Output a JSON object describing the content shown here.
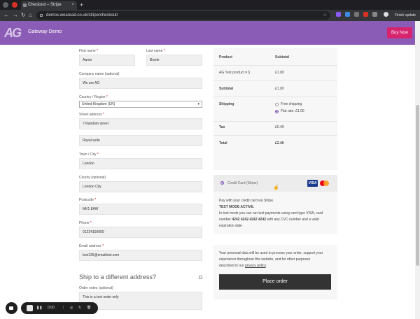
{
  "browser": {
    "tab_title": "Checkout – Stripe",
    "url": "demos.wearead.co.uk/stripe/checkout/",
    "update_label": "Finish update"
  },
  "header": {
    "logo_text": "AG",
    "brand": "Gateway Demo",
    "buy_now": "Buy Now"
  },
  "billing": {
    "first_name_label": "First name",
    "first_name": "Aaron",
    "last_name_label": "Last name",
    "last_name": "Bowie",
    "company_label": "Company name (optional)",
    "company": "We are AG",
    "country_label": "Country / Region",
    "country": "United Kingdom (UK)",
    "street_label": "Street address",
    "street1": "7 Random street",
    "street2": "Royal suite",
    "city_label": "Town / City",
    "city": "London",
    "county_label": "County (optional)",
    "county": "London City",
    "postcode_label": "Postcode",
    "postcode": "MK1 8AW",
    "phone_label": "Phone",
    "phone": "01224100000",
    "email_label": "Email address",
    "email": "test135@emailtest.com",
    "required_mark": "*"
  },
  "shipping": {
    "ship_diff_label": "Ship to a different address?",
    "notes_label": "Order notes (optional)",
    "notes": "This is a test order only"
  },
  "order": {
    "col_product": "Product",
    "col_subtotal": "Subtotal",
    "item_name": "AG Test product",
    "item_qty": "× 1",
    "item_price": "£1.00",
    "subtotal_label": "Subtotal",
    "subtotal": "£1.00",
    "shipping_label": "Shipping",
    "free_shipping": "Free shipping",
    "flat_rate": "Flat rate: £1.00",
    "tax_label": "Tax",
    "tax": "£0.40",
    "total_label": "Total",
    "total": "£2.40"
  },
  "payment": {
    "method_label": "Credit Card (Stripe)",
    "visa": "VISA",
    "desc": "Pay with your credit card via Stripe.",
    "test_mode": "TEST MODE ACTIVE.",
    "test_line1": "In test mode you can run test payments using card type VISA, card",
    "test_line2_pre": "number ",
    "test_card": "4242 4242 4242 4242",
    "test_line2_post": " with any CVC number and a valid",
    "test_line3": "expiration date"
  },
  "privacy": {
    "line1": "Your personal data will be used to process your order, support your",
    "line2": "experience throughout this website, and for other purposes",
    "line3_pre": "described in our ",
    "policy_link": "privacy policy",
    "line3_post": ".",
    "place_order": "Place order"
  },
  "recorder": {
    "time": "0:00"
  },
  "colors": {
    "header": "#8b5cb5",
    "buy_now": "#d6246e",
    "place_order": "#333333",
    "accent": "#7b4fb0"
  }
}
